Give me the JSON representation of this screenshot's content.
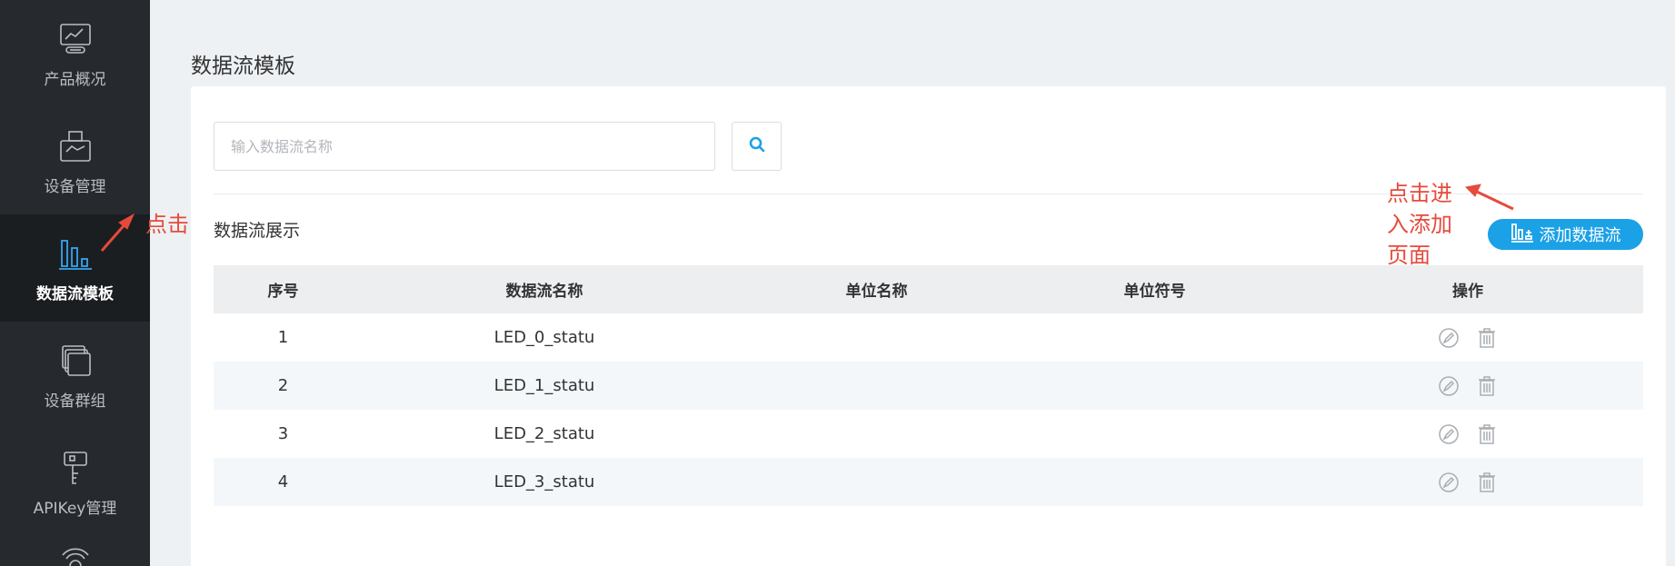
{
  "sidebar": {
    "items": [
      {
        "label": "产品概况",
        "icon": "chart-monitor-icon"
      },
      {
        "label": "设备管理",
        "icon": "device-box-icon"
      },
      {
        "label": "数据流模板",
        "icon": "bar-chart-icon",
        "active": true
      },
      {
        "label": "设备群组",
        "icon": "stack-icon"
      },
      {
        "label": "APIKey管理",
        "icon": "key-icon"
      },
      {
        "label": "",
        "icon": "signal-icon"
      }
    ]
  },
  "header": {
    "title": "数据流模板"
  },
  "search": {
    "placeholder": "输入数据流名称",
    "value": ""
  },
  "section": {
    "label": "数据流展示"
  },
  "add_button": {
    "label": "添加数据流"
  },
  "table": {
    "columns": [
      "序号",
      "数据流名称",
      "单位名称",
      "单位符号",
      "操作"
    ],
    "rows": [
      {
        "index": "1",
        "name": "LED_0_statu",
        "unit_name": "",
        "unit_symbol": ""
      },
      {
        "index": "2",
        "name": "LED_1_statu",
        "unit_name": "",
        "unit_symbol": ""
      },
      {
        "index": "3",
        "name": "LED_2_statu",
        "unit_name": "",
        "unit_symbol": ""
      },
      {
        "index": "4",
        "name": "LED_3_statu",
        "unit_name": "",
        "unit_symbol": ""
      }
    ]
  },
  "annotations": {
    "click_sidebar": "点击",
    "click_add_line1": "点击进",
    "click_add_line2": "入添加",
    "click_add_line3": "页面"
  },
  "colors": {
    "accent": "#1ba1e6",
    "sidebar_bg": "#262a2e",
    "annotation": "#e64a3b"
  }
}
